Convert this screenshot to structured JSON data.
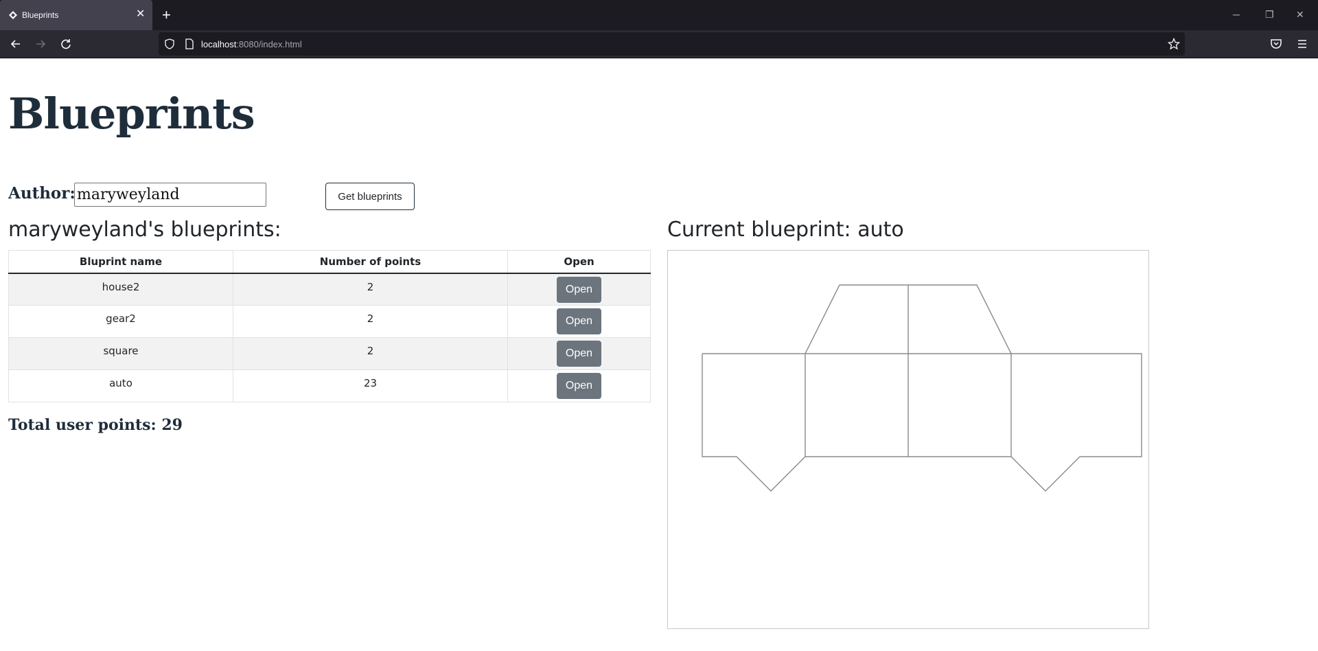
{
  "browser": {
    "tab_title": "Blueprints",
    "url_host": "localhost",
    "url_rest": ":8080/index.html"
  },
  "page": {
    "heading": "Blueprints",
    "author_label": "Author:",
    "author_value": "maryweyland",
    "get_button": "Get blueprints",
    "list_title": "maryweyland's blueprints:",
    "total_label": "Total user points: 29",
    "current_title": "Current blueprint: auto"
  },
  "table": {
    "headers": [
      "Bluprint name",
      "Number of points",
      "Open"
    ],
    "rows": [
      {
        "name": "house2",
        "points": "2",
        "action": "Open"
      },
      {
        "name": "gear2",
        "points": "2",
        "action": "Open"
      },
      {
        "name": "square",
        "points": "2",
        "action": "Open"
      },
      {
        "name": "auto",
        "points": "23",
        "action": "Open"
      }
    ]
  }
}
